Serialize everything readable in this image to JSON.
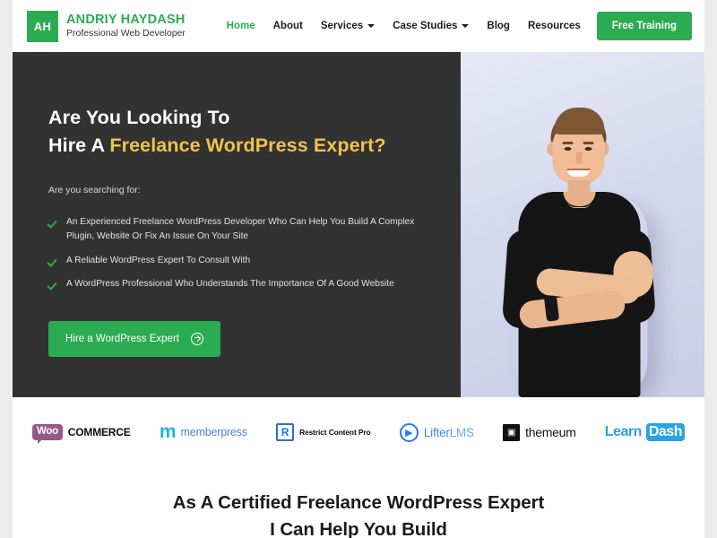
{
  "brand": {
    "badge": "AH",
    "name": "ANDRIY HAYDASH",
    "tagline": "Professional Web Developer",
    "badge_color": "#2cac52",
    "name_color": "#2cac52"
  },
  "nav": {
    "items": [
      {
        "label": "Home",
        "active": true,
        "has_dropdown": false
      },
      {
        "label": "About",
        "active": false,
        "has_dropdown": false
      },
      {
        "label": "Services",
        "active": false,
        "has_dropdown": true
      },
      {
        "label": "Case Studies",
        "active": false,
        "has_dropdown": true
      },
      {
        "label": "Blog",
        "active": false,
        "has_dropdown": false
      },
      {
        "label": "Resources",
        "active": false,
        "has_dropdown": false
      }
    ],
    "cta_label": "Free Training",
    "cta_color": "#2cac52",
    "active_color": "#2cac52"
  },
  "hero": {
    "background_color": "#323232",
    "accent_color": "#f2c14a",
    "heading_line1": "Are You Looking To",
    "heading_line2_prefix": "Hire A ",
    "heading_line2_accent": "Freelance WordPress Expert?",
    "subheading": "Are you searching for:",
    "bullets": [
      "An Experienced Freelance WordPress Developer Who Can Help You Build A Complex Plugin, Website Or Fix An Issue On Your Site",
      "A Reliable WordPress Expert To Consult With",
      "A WordPress Professional Who Understands The Importance Of A Good Website"
    ],
    "cta_label": "Hire a WordPress Expert",
    "cta_color": "#2cac52",
    "image_alt": "Smiling man with arms crossed wearing a black t-shirt"
  },
  "logos": {
    "items": [
      {
        "name": "WooCommerce",
        "badge": "Woo",
        "word": "COMMERCE",
        "color": "#96588a"
      },
      {
        "name": "MemberPress",
        "mark": "m",
        "word": "memberpress",
        "color": "#4f7fd4"
      },
      {
        "name": "Restrict Content Pro",
        "mark": "R",
        "word": "Restrict Content Pro",
        "color": "#2a6fd6"
      },
      {
        "name": "LifterLMS",
        "mark": "▶",
        "word_bold": "Lifter",
        "word_light": "LMS",
        "color": "#3a86e8"
      },
      {
        "name": "themeum",
        "mark": "▣",
        "word": "themeum",
        "color": "#111111"
      },
      {
        "name": "LearnDash",
        "word_a": "Learn",
        "word_b": "Dash",
        "color": "#29a3e3"
      }
    ]
  },
  "bottom": {
    "heading_line1": "As A Certified Freelance WordPress Expert",
    "heading_line2": "I Can Help You Build"
  }
}
